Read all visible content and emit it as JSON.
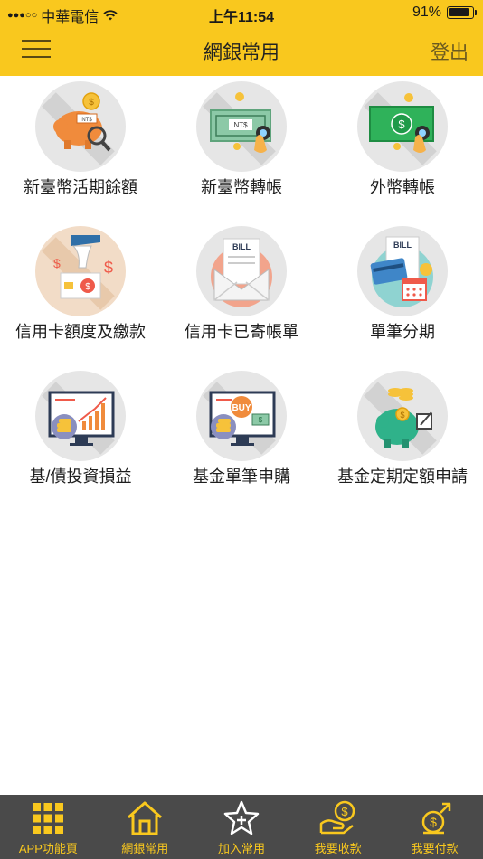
{
  "status_bar": {
    "carrier": "中華電信",
    "time": "上午11:54",
    "battery": "91%",
    "battery_level": 0.91
  },
  "header": {
    "title": "網銀常用",
    "logout_label": "登出",
    "menu_icon": "hamburger-menu-icon"
  },
  "tiles": [
    {
      "label": "新臺幣活期餘額",
      "icon": "piggy-bank-search-icon"
    },
    {
      "label": "新臺幣轉帳",
      "icon": "ntd-banknote-transfer-icon"
    },
    {
      "label": "外幣轉帳",
      "icon": "foreign-currency-banknote-icon"
    },
    {
      "label": "信用卡額度及繳款",
      "icon": "credit-card-payment-icon"
    },
    {
      "label": "信用卡已寄帳單",
      "icon": "bill-envelope-icon"
    },
    {
      "label": "單筆分期",
      "icon": "bill-card-calendar-icon"
    },
    {
      "label": "基/債投資損益",
      "icon": "investment-chart-icon"
    },
    {
      "label": "基金單筆申購",
      "icon": "fund-buy-icon"
    },
    {
      "label": "基金定期定額申請",
      "icon": "piggy-bank-coins-icon"
    }
  ],
  "tab_bar": [
    {
      "label": "APP功能頁",
      "icon": "grid-apps-icon"
    },
    {
      "label": "網銀常用",
      "icon": "home-icon"
    },
    {
      "label": "加入常用",
      "icon": "star-plus-icon"
    },
    {
      "label": "我要收款",
      "icon": "hand-dollar-icon"
    },
    {
      "label": "我要付款",
      "icon": "dollar-send-icon"
    }
  ],
  "colors": {
    "brand_yellow": "#f9c81e",
    "tab_bar_bg": "#4a4a4a",
    "tab_label": "#f9c81e"
  }
}
